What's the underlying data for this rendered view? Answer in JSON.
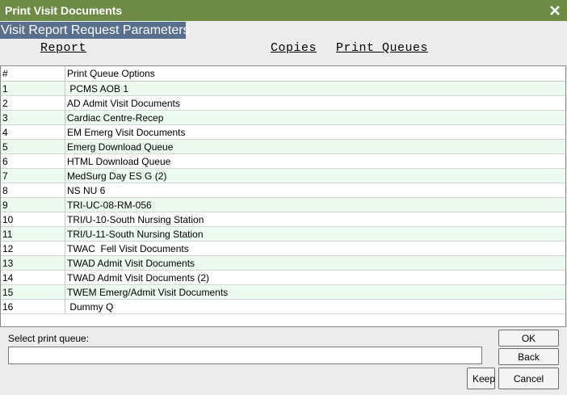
{
  "window": {
    "title": "Print Visit Documents",
    "close_icon": "close-icon"
  },
  "section_title": "Visit Report Request Parameters",
  "columns_header": {
    "report": "Report",
    "copies": "Copies",
    "print_queues": "Print Queues"
  },
  "table": {
    "headers": {
      "num": "#",
      "name": "Print Queue Options"
    },
    "rows": [
      {
        "num": "1",
        "name": " PCMS AOB 1"
      },
      {
        "num": "2",
        "name": "AD Admit Visit Documents"
      },
      {
        "num": "3",
        "name": "Cardiac Centre-Recep"
      },
      {
        "num": "4",
        "name": "EM Emerg Visit Documents"
      },
      {
        "num": "5",
        "name": "Emerg Download Queue"
      },
      {
        "num": "6",
        "name": "HTML Download Queue"
      },
      {
        "num": "7",
        "name": "MedSurg Day ES G (2)"
      },
      {
        "num": "8",
        "name": "NS NU 6"
      },
      {
        "num": "9",
        "name": "TRI-UC-08-RM-056"
      },
      {
        "num": "10",
        "name": "TRI/U-10-South Nursing Station"
      },
      {
        "num": "11",
        "name": "TRI/U-11-South Nursing Station"
      },
      {
        "num": "12",
        "name": "TWAC  Fell Visit Documents"
      },
      {
        "num": "13",
        "name": "TWAD Admit Visit Documents"
      },
      {
        "num": "14",
        "name": "TWAD Admit Visit Documents (2)"
      },
      {
        "num": "15",
        "name": "TWEM Emerg/Admit Visit Documents"
      },
      {
        "num": "16",
        "name": " Dummy Q"
      }
    ]
  },
  "select_label": "Select print queue:",
  "select_value": "",
  "buttons": {
    "ok": "OK",
    "back": "Back",
    "keep": "Keep",
    "cancel": "Cancel"
  },
  "colors": {
    "title_bar": "#6e8c46",
    "section_title_bg": "#5a6e8e",
    "row_alt": "#ecfaf0"
  }
}
